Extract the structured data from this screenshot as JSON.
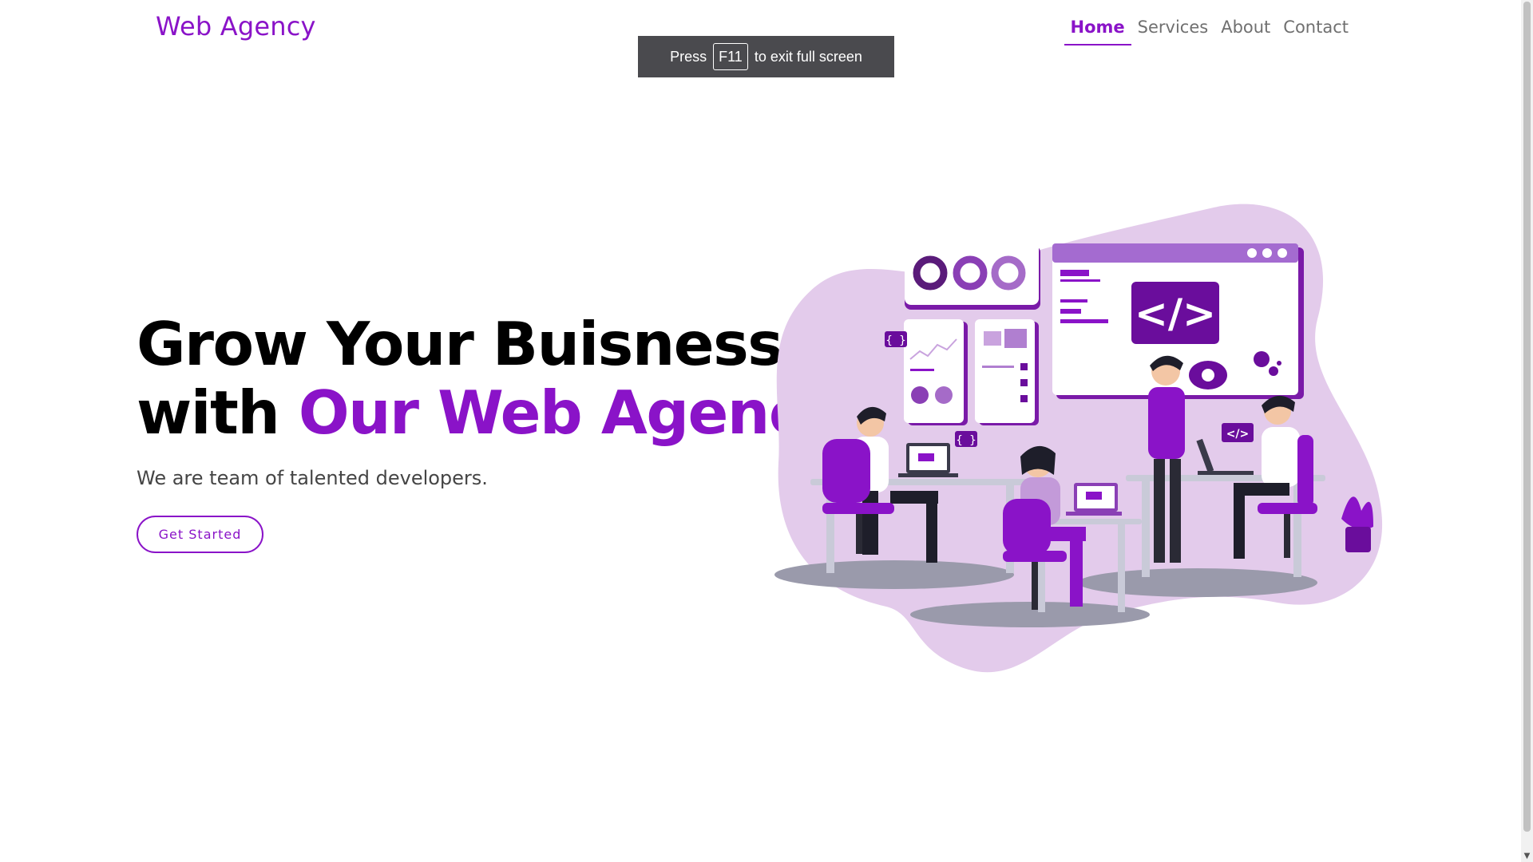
{
  "header": {
    "brand": "Web Agency",
    "nav": [
      {
        "label": "Home",
        "active": true
      },
      {
        "label": "Services",
        "active": false
      },
      {
        "label": "About",
        "active": false
      },
      {
        "label": "Contact",
        "active": false
      }
    ]
  },
  "fullscreen_toast": {
    "prefix": "Press",
    "key": "F11",
    "suffix": "to exit full screen"
  },
  "hero": {
    "title_line1": "Grow Your Buisness",
    "title_line2_prefix": "with ",
    "title_line2_accent": "Our Web Agency",
    "subtitle": "We are team of talented developers.",
    "cta_label": "Get Started"
  },
  "illustration": {
    "code_symbol": "</>",
    "braces_symbol": "{ }"
  },
  "colors": {
    "accent": "#8a13c8",
    "blob": "#e3cbeb",
    "toast_bg": "#4a4a4e"
  }
}
